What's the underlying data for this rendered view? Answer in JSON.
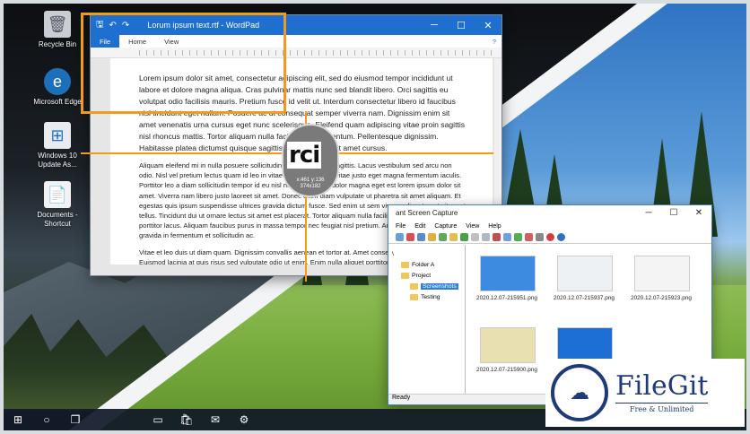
{
  "desktop": {
    "icons": [
      {
        "label": "Recycle Bin",
        "icon": "recycle-bin-icon"
      },
      {
        "label": "Microsoft Edge",
        "icon": "edge-icon"
      },
      {
        "label": "Windows 10 Update As...",
        "icon": "windows-update-icon"
      },
      {
        "label": "Documents - Shortcut",
        "icon": "documents-shortcut-icon"
      }
    ]
  },
  "wordpad": {
    "title": "Lorum ipsum text.rtf - WordPad",
    "menu": {
      "file": "File",
      "home": "Home",
      "view": "View"
    },
    "paragraphs": [
      "Lorem ipsum dolor sit amet, consectetur adipiscing elit, sed do eiusmod tempor incididunt ut labore et dolore magna aliqua. Cras pulvinar mattis nunc sed blandit libero. Orci sagittis eu volutpat odio facilisis mauris. Pretium fusce id velit ut. Interdum consectetur libero id faucibus nisl tincidunt eget nullam. Posuere ac ut consequat semper viverra nam. Dignissim enim sit amet venenatis urna cursus eget nunc scelerisque. Eleifend quam adipiscing vitae proin sagittis nisl rhoncus mattis. Tortor aliquam nulla facilisi cras fermentum. Pellentesque dignissim. Habitasse platea dictumst quisque sagittis. Justo laoreet sit amet cursus.",
      "Aliquam eleifend mi in nulla posuere sollicitudin aliquam ultrices sagittis. Lacus vestibulum sed arcu non odio. Nisl vel pretium lectus quam id leo in vitae. Est sem integer vitae justo eget magna fermentum iaculis. Porttitor leo a diam sollicitudin tempor id eu nisl nunc. Hendrerit dolor magna eget est lorem ipsum dolor sit amet. Viverra nam libero justo laoreet sit amet. Donec enim diam vulputate ut pharetra sit amet aliquam. Et egestas quis ipsum suspendisse ultrices gravida dictum fusce. Sed enim ut sem viverra aliquet eget sit amet tellus. Tincidunt dui ut ornare lectus sit amet est placerat. Tortor aliquam nulla facilisi cras. Enim nulla aliquet porttitor lacus. Aliquam faucibus purus in massa tempor nec feugiat nisl pretium. Augue mauris augue neque gravida in fermentum et sollicitudin ac.",
      "Vitae et leo duis ut diam quam. Dignissim convallis aenean et tortor at. Amet consectetur adipiscing. Euismod lacinia at quis risus sed vulputate odio ut enim. Enim nulla aliquet porttitor lacus luctus accumsan tortor posuere. Dignissim sodales ut eu sem integer vitae. Amet luctus venenatis lectus magna fringilla urna porttitor rhoncus dolor egestas integer. Pulvinar sapien et ligula ullamcorper malesuada proin libero nunc consequat."
    ]
  },
  "magnifier": {
    "zoom_text": "rci",
    "coords": "x:461 y:136",
    "size": "374x182"
  },
  "capture": {
    "title": "ant Screen Capture",
    "menu": [
      "File",
      "Edit",
      "Capture",
      "View",
      "Help"
    ],
    "tree": [
      {
        "label": "\\"
      },
      {
        "label": "Folder A"
      },
      {
        "label": "Project"
      },
      {
        "label": "Screenshots",
        "selected": true
      },
      {
        "label": "Testing"
      }
    ],
    "thumbs": [
      {
        "caption": "2020.12.07-215951.png",
        "tone": "#3d8be0"
      },
      {
        "caption": "2020.12.07-215937.png",
        "tone": "#eef1f4"
      },
      {
        "caption": "2020.12.07-215923.png",
        "tone": "#f4f4f4"
      },
      {
        "caption": "2020.12.07-215900.png",
        "tone": "#e8e0b0"
      },
      {
        "caption": "",
        "tone": "#1d6fd6"
      }
    ],
    "status": "Ready"
  },
  "taskbar": {
    "items": [
      "start-icon",
      "search-icon",
      "task-view-icon",
      "file-explorer-icon",
      "store-icon",
      "mail-icon",
      "settings-icon"
    ]
  },
  "badge": {
    "name": "FileGit",
    "tagline": "Free & Unlimited"
  }
}
